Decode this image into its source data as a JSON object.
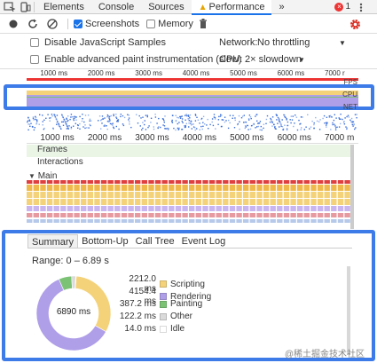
{
  "tabs": [
    {
      "label": "Elements"
    },
    {
      "label": "Console"
    },
    {
      "label": "Sources"
    },
    {
      "label": "Performance"
    }
  ],
  "more_tabs": "»",
  "error_count": "1",
  "toolbar": {
    "screenshots_label": "Screenshots",
    "memory_label": "Memory"
  },
  "settings": {
    "disable_js_samples": "Disable JavaScript Samples",
    "network_label": "Network:",
    "network_value": "No throttling",
    "paint_instr": "Enable advanced paint instrumentation (slow)",
    "cpu_label": "CPU:",
    "cpu_value": "2× slowdown"
  },
  "overview": {
    "ticks": [
      "1000 ms",
      "2000 ms",
      "3000 ms",
      "4000 ms",
      "5000 ms",
      "6000 ms",
      "7000 r"
    ],
    "fps_label": "FPS",
    "cpu_label": "CPU",
    "net_label": "NET"
  },
  "timeline": {
    "ticks": [
      "1000 ms",
      "2000 ms",
      "3000 ms",
      "4000 ms",
      "5000 ms",
      "6000 ms",
      "7000 m"
    ],
    "frames_label": "Frames",
    "interactions_label": "Interactions",
    "main_label": "Main"
  },
  "bottom_tabs": [
    {
      "label": "Summary"
    },
    {
      "label": "Bottom-Up"
    },
    {
      "label": "Call Tree"
    },
    {
      "label": "Event Log"
    }
  ],
  "summary": {
    "range": "Range: 0 – 6.89 s",
    "total": "6890 ms",
    "items": [
      {
        "value": "2212.0 ms",
        "label": "Scripting",
        "color": "#f3d27a"
      },
      {
        "value": "4154.4 ms",
        "label": "Rendering",
        "color": "#af9ee8"
      },
      {
        "value": "387.2 ms",
        "label": "Painting",
        "color": "#7cc275"
      },
      {
        "value": "122.2 ms",
        "label": "Other",
        "color": "#dadada"
      },
      {
        "value": "14.0 ms",
        "label": "Idle",
        "color": "#ffffff"
      }
    ]
  },
  "watermark": "@稀土掘金技术社区",
  "colors": {
    "accent": "#1a73e8",
    "highlight": "#3d7be8",
    "scripting": "#f3d27a",
    "rendering": "#af9ee8",
    "painting": "#7cc275"
  }
}
